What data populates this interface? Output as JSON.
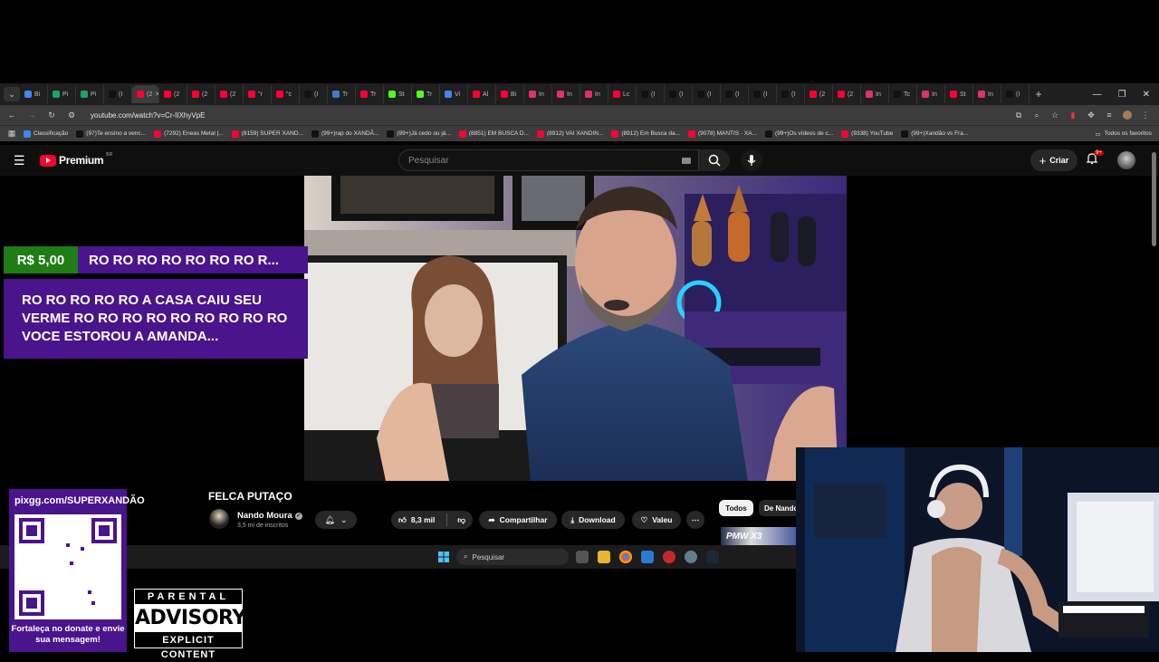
{
  "browser": {
    "tabs": [
      {
        "label": "Bi",
        "color": "#4285f4"
      },
      {
        "label": "Pi",
        "color": "#1da462"
      },
      {
        "label": "Pi",
        "color": "#1da462"
      },
      {
        "label": "(I",
        "color": "#111111"
      },
      {
        "label": "(2",
        "color": "#ff0033",
        "active": true
      },
      {
        "label": "(2",
        "color": "#ff0033"
      },
      {
        "label": "(2",
        "color": "#ff0033"
      },
      {
        "label": "(2",
        "color": "#ff0033"
      },
      {
        "label": "\"r",
        "color": "#ff0033"
      },
      {
        "label": "\"c",
        "color": "#ff0033"
      },
      {
        "label": "(I",
        "color": "#111111"
      },
      {
        "label": "Tr",
        "color": "#3d7dca"
      },
      {
        "label": "Tr",
        "color": "#ff0033"
      },
      {
        "label": "St",
        "color": "#53fc18"
      },
      {
        "label": "Tr",
        "color": "#53fc18"
      },
      {
        "label": "Vi",
        "color": "#4285f4"
      },
      {
        "label": "Al",
        "color": "#ff0033"
      },
      {
        "label": "Bi",
        "color": "#ff0033"
      },
      {
        "label": "In",
        "color": "#e1306c"
      },
      {
        "label": "In",
        "color": "#e1306c"
      },
      {
        "label": "In",
        "color": "#e1306c"
      },
      {
        "label": "Lc",
        "color": "#ff0033"
      },
      {
        "label": "(I",
        "color": "#111111"
      },
      {
        "label": "(I",
        "color": "#111111"
      },
      {
        "label": "(I",
        "color": "#111111"
      },
      {
        "label": "(I",
        "color": "#111111"
      },
      {
        "label": "(I",
        "color": "#111111"
      },
      {
        "label": "(I",
        "color": "#111111"
      },
      {
        "label": "(2",
        "color": "#ff0033"
      },
      {
        "label": "(2",
        "color": "#ff0033"
      },
      {
        "label": "In",
        "color": "#e1306c"
      },
      {
        "label": "Tc",
        "color": "#111111"
      },
      {
        "label": "In",
        "color": "#e1306c"
      },
      {
        "label": "St",
        "color": "#ff0033"
      },
      {
        "label": "In",
        "color": "#e1306c"
      },
      {
        "label": "(I",
        "color": "#111111"
      }
    ],
    "url": "youtube.com/watch?v=Cr-IIXhyVpE",
    "bookmarks": [
      {
        "label": "Classificação",
        "color": "#4285f4"
      },
      {
        "label": "(97)Te ensino a venc...",
        "color": "#111111"
      },
      {
        "label": "(7292) Eneas Metal |...",
        "color": "#ff0033"
      },
      {
        "label": "(8159) SUPER XAND...",
        "color": "#ff0033"
      },
      {
        "label": "(99+)rap do XANDÃ...",
        "color": "#111111"
      },
      {
        "label": "(99+)Já cedo ou já...",
        "color": "#111111"
      },
      {
        "label": "(8851) EM BUSCA D...",
        "color": "#ff0033"
      },
      {
        "label": "(8912) VAI XANDIN...",
        "color": "#ff0033"
      },
      {
        "label": "(8912) Em Busca da...",
        "color": "#ff0033"
      },
      {
        "label": "(9078) MANTIS · XA...",
        "color": "#ff0033"
      },
      {
        "label": "(99+)Os vídeos de c...",
        "color": "#111111"
      },
      {
        "label": "(9338) YouTube",
        "color": "#ff0033"
      },
      {
        "label": "(99+)Xandão vs Fra...",
        "color": "#111111"
      }
    ],
    "all_bookmarks": "Todos os favoritos"
  },
  "youtube": {
    "logo": "Premium",
    "country": "BR",
    "search_placeholder": "Pesquisar",
    "create_label": "Criar",
    "notif_count": "9+"
  },
  "superchat": {
    "amount": "R$ 5,00",
    "title": "RO RO RO RO RO RO RO R...",
    "message": "RO RO RO RO RO A CASA CAIU SEU VERME RO RO RO RO RO RO RO RO RO VOCE ESTOROU A AMANDA..."
  },
  "video": {
    "title": "FELCA PUTAÇO",
    "channel": "Nando Moura",
    "subscribers": "3,5 mi de inscritos",
    "likes": "8,3 mil",
    "share_label": "Compartilhar",
    "download_label": "Download",
    "thanks_label": "Valeu",
    "chips": [
      "Todos",
      "De Nando"
    ],
    "thumb_text": "PMW X3"
  },
  "taskbar": {
    "search_label": "Pesquisar"
  },
  "overlay": {
    "qr_url": "pixgg.com/SUPERXANDÃO",
    "qr_caption": "Fortaleça no donate e envie sua mensagem!",
    "advisory_top": "PARENTAL",
    "advisory_mid": "ADVISORY",
    "advisory_bottom": "EXPLICIT CONTENT"
  },
  "colors": {
    "superchat_purple": "#4a148c",
    "superchat_green": "#1e7d15",
    "youtube_red": "#ff0033"
  }
}
